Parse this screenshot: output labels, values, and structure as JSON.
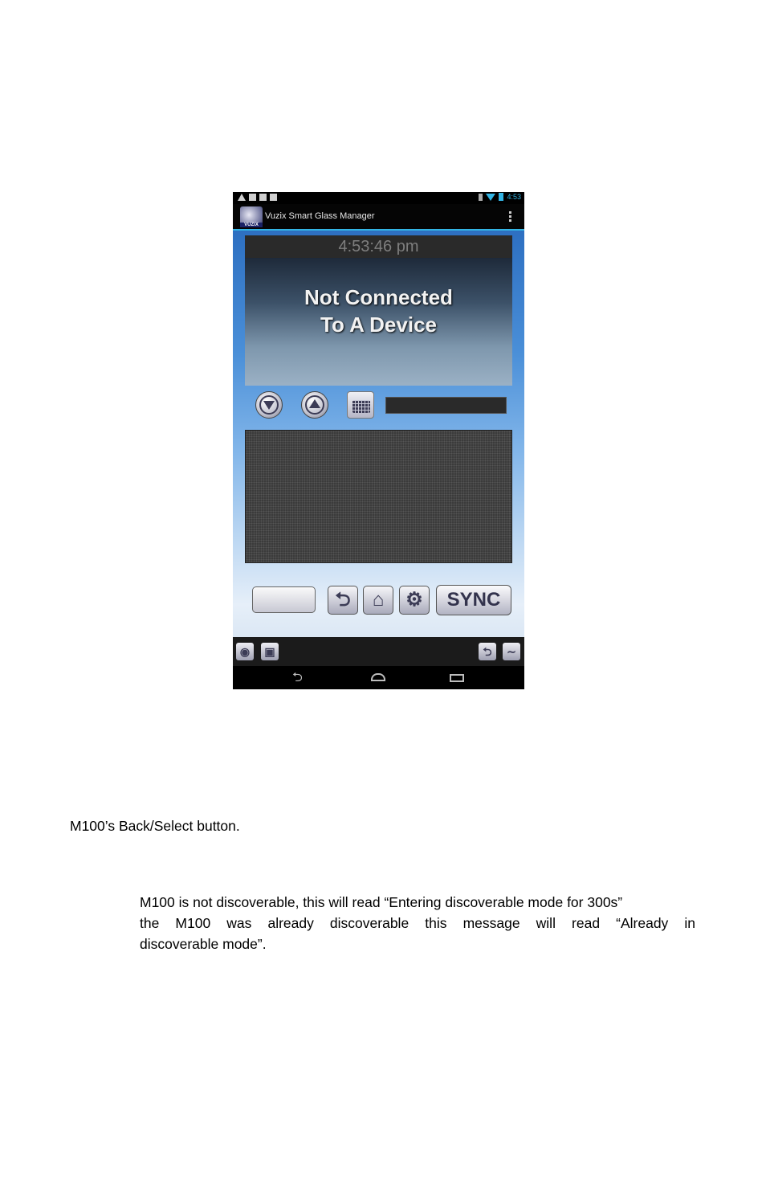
{
  "phone": {
    "status_time": "4:53",
    "app_title": "Vuzix Smart Glass Manager",
    "app_logo_text": "VUZIX",
    "clock": "4:53:46 pm",
    "banner_line1": "Not Connected",
    "banner_line2": "To A Device",
    "sync_label": "SYNC",
    "icons": {
      "down": "arrow-down-circle-icon",
      "up": "arrow-up-circle-icon",
      "keyboard": "keyboard-icon",
      "back": "back-arrow-icon",
      "home": "home-icon",
      "settings": "gear-icon"
    }
  },
  "document": {
    "line_back_select": "M100’s Back/Select button.",
    "para_line1": "M100 is not discoverable, this will read “Entering discoverable mode for 300s”",
    "para_line2": "the M100 was already discoverable this message will read “Already in",
    "para_line3": "discoverable mode”."
  }
}
